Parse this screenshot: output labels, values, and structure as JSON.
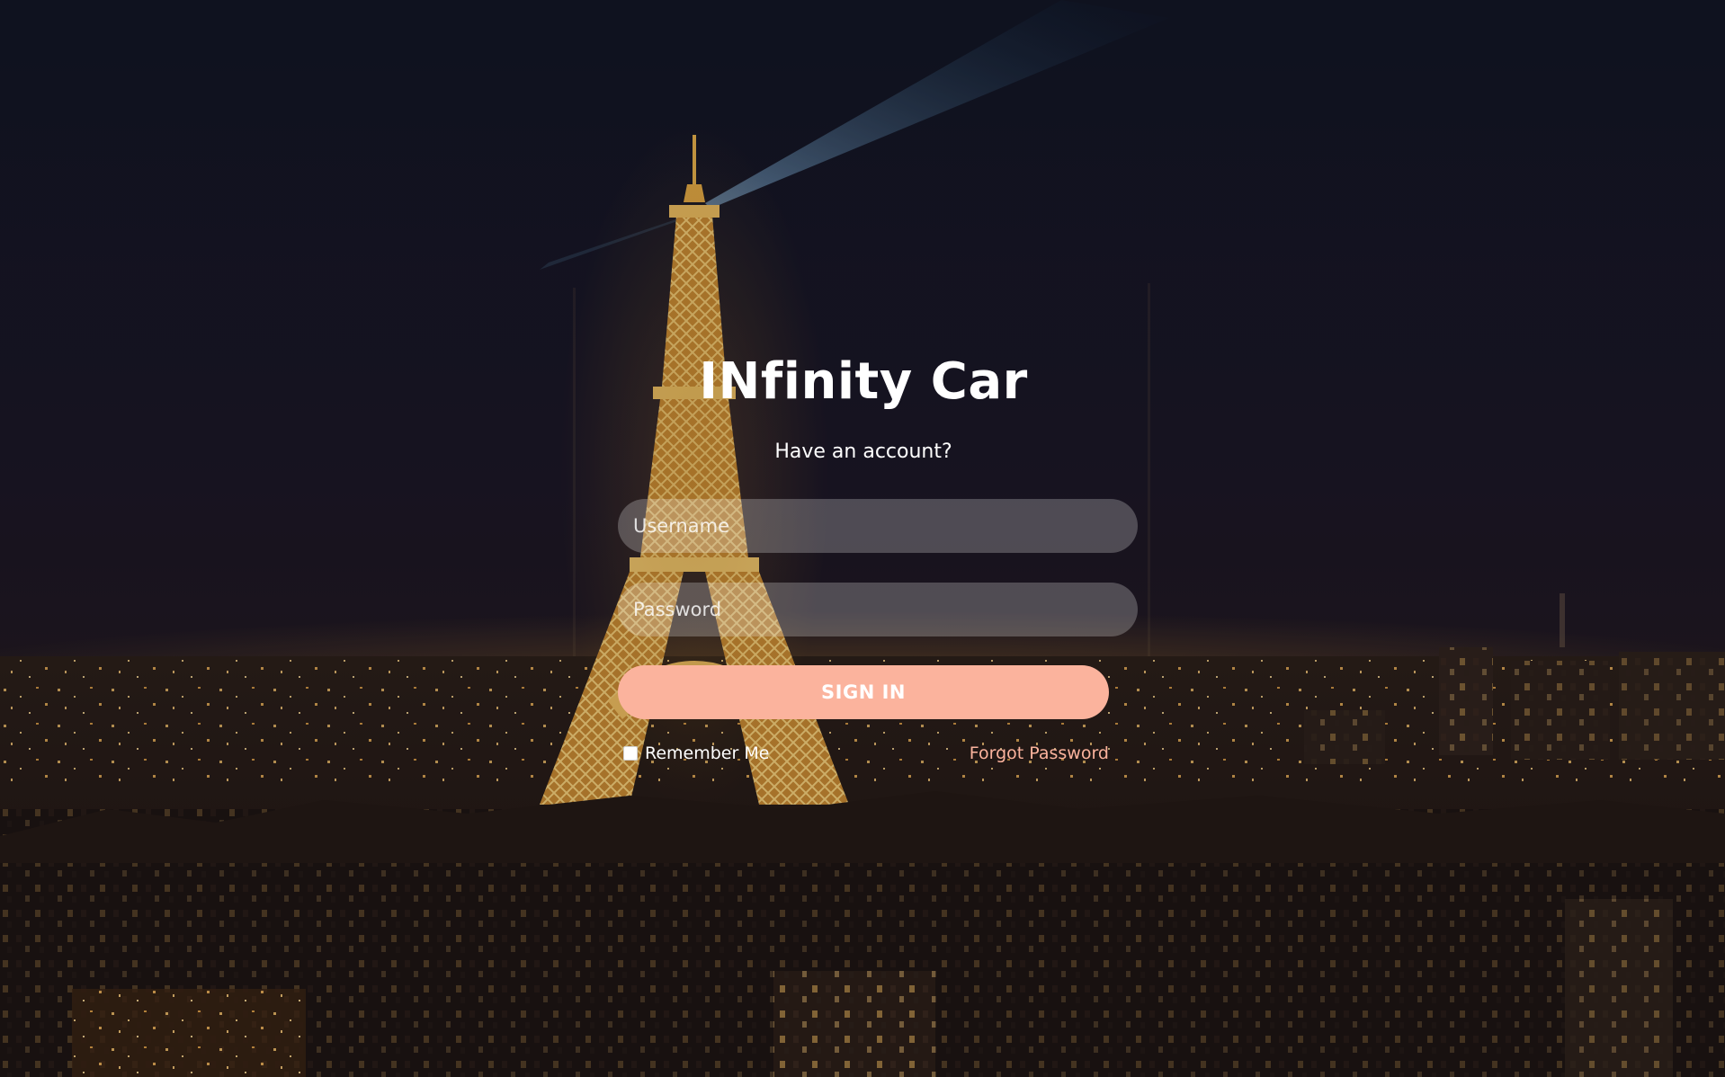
{
  "app": {
    "title": "INfinity Car",
    "subtitle": "Have an account?"
  },
  "form": {
    "username_placeholder": "Username",
    "password_placeholder": "Password",
    "signin_label": "SIGN IN",
    "remember_label": "Remember Me",
    "remember_checked": false,
    "forgot_label": "Forgot Password"
  },
  "background": {
    "description_icon": "paris-night-skyline-image"
  },
  "colors": {
    "accent": "#fbb39d",
    "text": "#ffffff",
    "field_bg": "rgba(255,255,255,0.24)"
  }
}
